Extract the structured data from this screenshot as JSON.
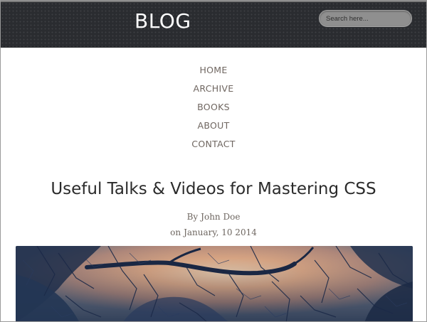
{
  "header": {
    "logo_text": "BLOG",
    "search_placeholder": "Search here..."
  },
  "nav": {
    "items": [
      {
        "label": "HOME"
      },
      {
        "label": "ARCHIVE"
      },
      {
        "label": "BOOKS"
      },
      {
        "label": "ABOUT"
      },
      {
        "label": "CONTACT"
      }
    ]
  },
  "post": {
    "title": "Useful Talks & Videos for Mastering CSS",
    "author_prefix": "By",
    "author": "John Doe",
    "date_prefix": "on",
    "date": "January, 10 2014"
  },
  "colors": {
    "header_bg": "#2a2c30",
    "nav_text": "#6f6660",
    "title_text": "#2b2b2b",
    "meta_text": "#6e6660"
  },
  "icons": {
    "photo": "winter-tree-branches-sunset-image"
  }
}
